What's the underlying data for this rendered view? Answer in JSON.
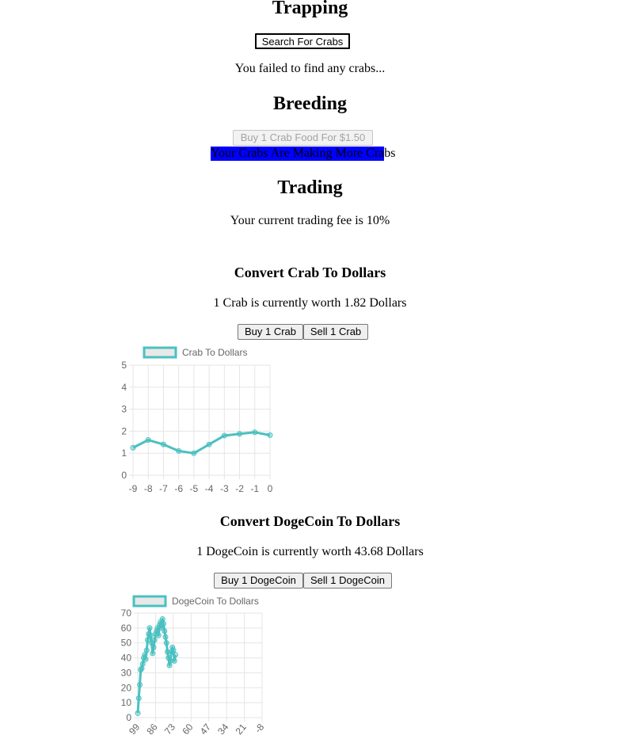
{
  "trapping": {
    "heading": "Trapping",
    "search_button": "Search For Crabs",
    "status": "You failed to find any crabs..."
  },
  "breeding": {
    "heading": "Breeding",
    "buy_food_button": "Buy 1 Crab Food For $1.50",
    "progress_label": "Your Crabs Are Making More Crabs",
    "progress_fraction": 0.94
  },
  "trading": {
    "heading": "Trading",
    "fee_text": "Your current trading fee is 10%"
  },
  "crab": {
    "heading": "Convert Crab To Dollars",
    "worth_text": "1 Crab is currently worth 1.82 Dollars",
    "buy_button": "Buy 1 Crab",
    "sell_button": "Sell 1 Crab"
  },
  "doge": {
    "heading": "Convert DogeCoin To Dollars",
    "worth_text": "1 DogeCoin is currently worth 43.68 Dollars",
    "buy_button": "Buy 1 DogeCoin",
    "sell_button": "Sell 1 DogeCoin"
  },
  "colors": {
    "series": "#4bc0c0",
    "progress": "#0000ff",
    "grid": "#e5e5e5",
    "tick": "#666666"
  },
  "chart_data": [
    {
      "type": "line",
      "series": [
        {
          "name": "Crab To Dollars",
          "x": [
            "-9",
            "-8",
            "-7",
            "-6",
            "-5",
            "-4",
            "-3",
            "-2",
            "-1",
            "0"
          ],
          "values": [
            1.25,
            1.6,
            1.4,
            1.1,
            1.0,
            1.4,
            1.8,
            1.88,
            1.95,
            1.82
          ]
        }
      ],
      "categories": [
        "-9",
        "-8",
        "-7",
        "-6",
        "-5",
        "-4",
        "-3",
        "-2",
        "-1",
        "0"
      ],
      "yticks": [
        "0",
        "1",
        "2",
        "3",
        "4",
        "5"
      ],
      "ylim": [
        0,
        5
      ],
      "grid": true,
      "legend": "top"
    },
    {
      "type": "line",
      "series": [
        {
          "name": "DogeCoin To Dollars",
          "values": [
            3,
            13,
            22,
            32,
            33,
            36,
            40,
            42,
            39,
            45,
            52,
            56,
            60,
            55,
            50,
            43,
            47,
            52,
            56,
            58,
            60,
            55,
            62,
            64,
            60,
            66,
            63,
            58,
            54,
            50,
            44,
            40,
            35,
            38,
            44,
            47,
            45,
            38,
            42
          ]
        }
      ],
      "xticks": [
        "99",
        "86",
        "73",
        "60",
        "47",
        "34",
        "21",
        "-8"
      ],
      "yticks": [
        "0",
        "10",
        "20",
        "30",
        "40",
        "50",
        "60",
        "70"
      ],
      "ylim": [
        0,
        70
      ],
      "grid": true,
      "legend": "top"
    }
  ]
}
